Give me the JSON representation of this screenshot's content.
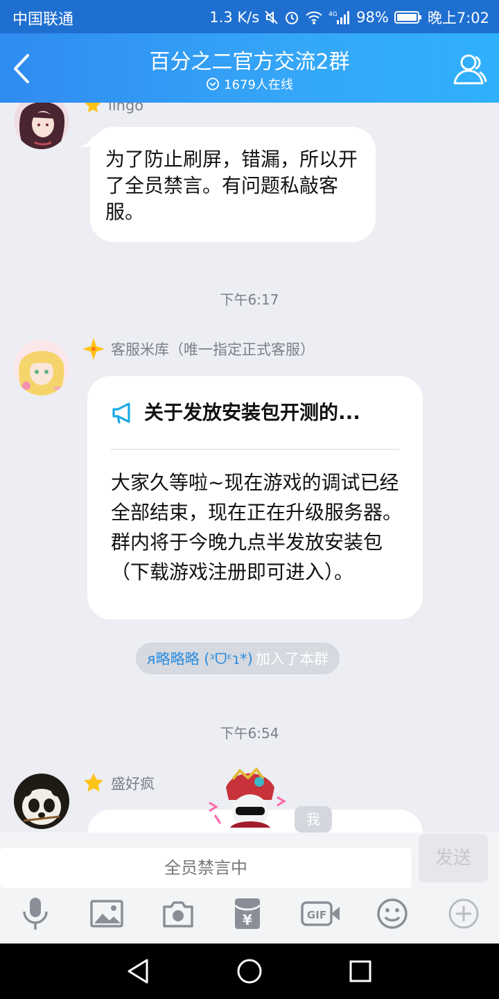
{
  "status_bar": {
    "carrier": "中国联通",
    "speed": "1.3 K/s",
    "battery": "98%",
    "time": "晚上7:02",
    "network": "4G"
  },
  "header": {
    "title": "百分之二官方交流2群",
    "online": "1679人在线"
  },
  "messages": {
    "m1": {
      "sender": "lingo",
      "text": "为了防止刷屏，错漏，所以开了全员禁言。有问题私敲客服。"
    },
    "ts1": "下午6:17",
    "m2": {
      "sender": "客服米库（唯一指定正式客服）",
      "card_title": "关于发放安装包开测的...",
      "card_body": "大家久等啦~现在游戏的调试已经全部结束，现在正在升级服务器。群内将于今晚九点半发放安装包（下载游戏注册即可进入）。"
    },
    "join": {
      "name": "ᴙ略略略 (ᵌᗜᵋɿ*)",
      "suffix": "加入了本群"
    },
    "ts2": "下午6:54",
    "m3": {
      "sender": "盛好疯",
      "tag": "我"
    }
  },
  "input": {
    "placeholder": "全员禁言中",
    "send_label": "发送"
  },
  "toolbar": {
    "icons": [
      "mic-icon",
      "image-icon",
      "camera-icon",
      "red-packet-icon",
      "gif-icon",
      "emoji-icon",
      "plus-icon"
    ]
  },
  "colors": {
    "header_start": "#2f8bf0",
    "header_end": "#2fb0fb",
    "accent": "#2a8ce0",
    "background": "#eceef3"
  }
}
